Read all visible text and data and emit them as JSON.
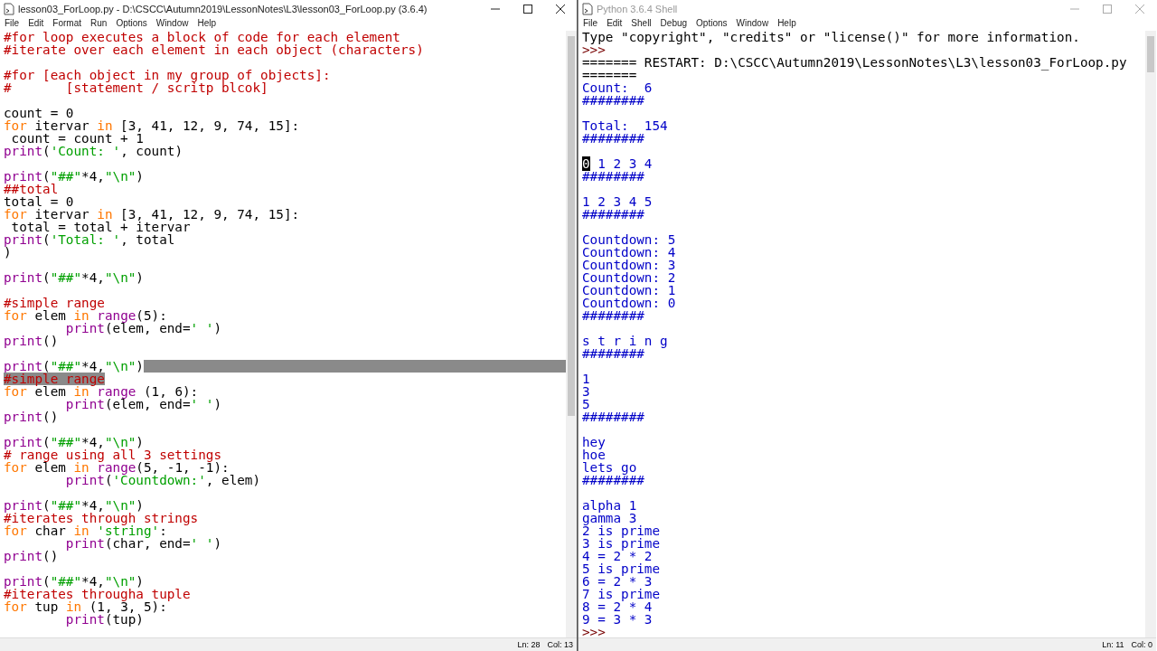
{
  "editor": {
    "title": "lesson03_ForLoop.py - D:\\CSCC\\Autumn2019\\LessonNotes\\L3\\lesson03_ForLoop.py (3.6.4)",
    "active": true,
    "menu": [
      "File",
      "Edit",
      "Format",
      "Run",
      "Options",
      "Window",
      "Help"
    ],
    "lines": [
      {
        "kind": "code",
        "tokens": [
          {
            "kind": "comment",
            "text": "#for loop executes a block of code for each element"
          }
        ]
      },
      {
        "kind": "code",
        "tokens": [
          {
            "kind": "comment",
            "text": "#iterate over each element in each object (characters)"
          }
        ]
      },
      {
        "kind": "blank"
      },
      {
        "kind": "code",
        "tokens": [
          {
            "kind": "comment",
            "text": "#for [each object in my group of objects]:"
          }
        ]
      },
      {
        "kind": "code",
        "tokens": [
          {
            "kind": "comment",
            "text": "#       [statement / scritp blcok]"
          }
        ]
      },
      {
        "kind": "blank"
      },
      {
        "kind": "code",
        "tokens": [
          {
            "kind": "plain",
            "text": "count = 0"
          }
        ]
      },
      {
        "kind": "code",
        "tokens": [
          {
            "kind": "keyword",
            "text": "for"
          },
          {
            "kind": "plain",
            "text": " itervar "
          },
          {
            "kind": "keyword",
            "text": "in"
          },
          {
            "kind": "plain",
            "text": " [3, 41, 12, 9, 74, 15]:"
          }
        ]
      },
      {
        "kind": "code",
        "tokens": [
          {
            "kind": "plain",
            "text": " count = count + 1"
          }
        ]
      },
      {
        "kind": "code",
        "tokens": [
          {
            "kind": "builtin",
            "text": "print"
          },
          {
            "kind": "plain",
            "text": "("
          },
          {
            "kind": "string",
            "text": "'Count: '"
          },
          {
            "kind": "plain",
            "text": ", count)"
          }
        ]
      },
      {
        "kind": "blank"
      },
      {
        "kind": "code",
        "tokens": [
          {
            "kind": "builtin",
            "text": "print"
          },
          {
            "kind": "plain",
            "text": "("
          },
          {
            "kind": "string",
            "text": "\"##\""
          },
          {
            "kind": "plain",
            "text": "*4,"
          },
          {
            "kind": "string",
            "text": "\"\\n\""
          },
          {
            "kind": "plain",
            "text": ")"
          }
        ]
      },
      {
        "kind": "code",
        "tokens": [
          {
            "kind": "comment",
            "text": "##total"
          }
        ]
      },
      {
        "kind": "code",
        "tokens": [
          {
            "kind": "plain",
            "text": "total = 0"
          }
        ]
      },
      {
        "kind": "code",
        "tokens": [
          {
            "kind": "keyword",
            "text": "for"
          },
          {
            "kind": "plain",
            "text": " itervar "
          },
          {
            "kind": "keyword",
            "text": "in"
          },
          {
            "kind": "plain",
            "text": " [3, 41, 12, 9, 74, 15]:"
          }
        ]
      },
      {
        "kind": "code",
        "tokens": [
          {
            "kind": "plain",
            "text": " total = total + itervar"
          }
        ]
      },
      {
        "kind": "code",
        "tokens": [
          {
            "kind": "builtin",
            "text": "print"
          },
          {
            "kind": "plain",
            "text": "("
          },
          {
            "kind": "string",
            "text": "'Total: '"
          },
          {
            "kind": "plain",
            "text": ", total"
          }
        ]
      },
      {
        "kind": "code",
        "tokens": [
          {
            "kind": "plain",
            "text": ")"
          }
        ]
      },
      {
        "kind": "blank"
      },
      {
        "kind": "code",
        "tokens": [
          {
            "kind": "builtin",
            "text": "print"
          },
          {
            "kind": "plain",
            "text": "("
          },
          {
            "kind": "string",
            "text": "\"##\""
          },
          {
            "kind": "plain",
            "text": "*4,"
          },
          {
            "kind": "string",
            "text": "\"\\n\""
          },
          {
            "kind": "plain",
            "text": ")"
          }
        ]
      },
      {
        "kind": "blank"
      },
      {
        "kind": "code",
        "tokens": [
          {
            "kind": "comment",
            "text": "#simple range"
          }
        ]
      },
      {
        "kind": "code",
        "tokens": [
          {
            "kind": "keyword",
            "text": "for"
          },
          {
            "kind": "plain",
            "text": " elem "
          },
          {
            "kind": "keyword",
            "text": "in "
          },
          {
            "kind": "builtin",
            "text": "range"
          },
          {
            "kind": "plain",
            "text": "(5):"
          }
        ]
      },
      {
        "kind": "code",
        "indented": true,
        "tokens": [
          {
            "kind": "builtin",
            "text": "print"
          },
          {
            "kind": "plain",
            "text": "(elem, end="
          },
          {
            "kind": "string",
            "text": "' '"
          },
          {
            "kind": "plain",
            "text": ")"
          }
        ]
      },
      {
        "kind": "code",
        "tokens": [
          {
            "kind": "builtin",
            "text": "print"
          },
          {
            "kind": "plain",
            "text": "()"
          }
        ]
      },
      {
        "kind": "blank"
      },
      {
        "kind": "code",
        "selection_tail": true,
        "tokens": [
          {
            "kind": "builtin",
            "text": "print"
          },
          {
            "kind": "plain",
            "text": "("
          },
          {
            "kind": "string",
            "text": "\"##\""
          },
          {
            "kind": "plain",
            "text": "*4,"
          },
          {
            "kind": "string",
            "text": "\"\\n\""
          },
          {
            "kind": "plain",
            "text": ")"
          }
        ]
      },
      {
        "kind": "code",
        "selected": true,
        "tokens": [
          {
            "kind": "comment",
            "text": "#simple range"
          }
        ]
      },
      {
        "kind": "code",
        "tokens": [
          {
            "kind": "keyword",
            "text": "for"
          },
          {
            "kind": "plain",
            "text": " elem "
          },
          {
            "kind": "keyword",
            "text": "in "
          },
          {
            "kind": "builtin",
            "text": "range"
          },
          {
            "kind": "plain",
            "text": " (1, 6):"
          }
        ]
      },
      {
        "kind": "code",
        "indented": true,
        "tokens": [
          {
            "kind": "builtin",
            "text": "print"
          },
          {
            "kind": "plain",
            "text": "(elem, end="
          },
          {
            "kind": "string",
            "text": "' '"
          },
          {
            "kind": "plain",
            "text": ")"
          }
        ]
      },
      {
        "kind": "code",
        "tokens": [
          {
            "kind": "builtin",
            "text": "print"
          },
          {
            "kind": "plain",
            "text": "()"
          }
        ]
      },
      {
        "kind": "blank"
      },
      {
        "kind": "code",
        "tokens": [
          {
            "kind": "builtin",
            "text": "print"
          },
          {
            "kind": "plain",
            "text": "("
          },
          {
            "kind": "string",
            "text": "\"##\""
          },
          {
            "kind": "plain",
            "text": "*4,"
          },
          {
            "kind": "string",
            "text": "\"\\n\""
          },
          {
            "kind": "plain",
            "text": ")"
          }
        ]
      },
      {
        "kind": "code",
        "tokens": [
          {
            "kind": "comment",
            "text": "# range using all 3 settings"
          }
        ]
      },
      {
        "kind": "code",
        "tokens": [
          {
            "kind": "keyword",
            "text": "for"
          },
          {
            "kind": "plain",
            "text": " elem "
          },
          {
            "kind": "keyword",
            "text": "in "
          },
          {
            "kind": "builtin",
            "text": "range"
          },
          {
            "kind": "plain",
            "text": "(5, -1, -1):"
          }
        ]
      },
      {
        "kind": "code",
        "indented": true,
        "tokens": [
          {
            "kind": "builtin",
            "text": "print"
          },
          {
            "kind": "plain",
            "text": "("
          },
          {
            "kind": "string",
            "text": "'Countdown:'"
          },
          {
            "kind": "plain",
            "text": ", elem)"
          }
        ]
      },
      {
        "kind": "blank"
      },
      {
        "kind": "code",
        "tokens": [
          {
            "kind": "builtin",
            "text": "print"
          },
          {
            "kind": "plain",
            "text": "("
          },
          {
            "kind": "string",
            "text": "\"##\""
          },
          {
            "kind": "plain",
            "text": "*4,"
          },
          {
            "kind": "string",
            "text": "\"\\n\""
          },
          {
            "kind": "plain",
            "text": ")"
          }
        ]
      },
      {
        "kind": "code",
        "tokens": [
          {
            "kind": "comment",
            "text": "#iterates through strings"
          }
        ]
      },
      {
        "kind": "code",
        "tokens": [
          {
            "kind": "keyword",
            "text": "for"
          },
          {
            "kind": "plain",
            "text": " char "
          },
          {
            "kind": "keyword",
            "text": "in "
          },
          {
            "kind": "string",
            "text": "'string'"
          },
          {
            "kind": "plain",
            "text": ":"
          }
        ]
      },
      {
        "kind": "code",
        "indented": true,
        "tokens": [
          {
            "kind": "builtin",
            "text": "print"
          },
          {
            "kind": "plain",
            "text": "(char, end="
          },
          {
            "kind": "string",
            "text": "' '"
          },
          {
            "kind": "plain",
            "text": ")"
          }
        ]
      },
      {
        "kind": "code",
        "tokens": [
          {
            "kind": "builtin",
            "text": "print"
          },
          {
            "kind": "plain",
            "text": "()"
          }
        ]
      },
      {
        "kind": "blank"
      },
      {
        "kind": "code",
        "tokens": [
          {
            "kind": "builtin",
            "text": "print"
          },
          {
            "kind": "plain",
            "text": "("
          },
          {
            "kind": "string",
            "text": "\"##\""
          },
          {
            "kind": "plain",
            "text": "*4,"
          },
          {
            "kind": "string",
            "text": "\"\\n\""
          },
          {
            "kind": "plain",
            "text": ")"
          }
        ]
      },
      {
        "kind": "code",
        "tokens": [
          {
            "kind": "comment",
            "text": "#iterates througha tuple"
          }
        ]
      },
      {
        "kind": "code",
        "tokens": [
          {
            "kind": "keyword",
            "text": "for"
          },
          {
            "kind": "plain",
            "text": " tup "
          },
          {
            "kind": "keyword",
            "text": "in"
          },
          {
            "kind": "plain",
            "text": " (1, 3, 5):"
          }
        ]
      },
      {
        "kind": "code",
        "indented": true,
        "tokens": [
          {
            "kind": "builtin",
            "text": "print"
          },
          {
            "kind": "plain",
            "text": "(tup)"
          }
        ]
      }
    ],
    "status": {
      "line": "Ln: 28",
      "column": "Col: 13"
    }
  },
  "shell": {
    "title": "Python 3.6.4 Shell",
    "active": false,
    "menu": [
      "File",
      "Edit",
      "Shell",
      "Debug",
      "Options",
      "Window",
      "Help"
    ],
    "lines": [
      {
        "kind": "code",
        "tokens": [
          {
            "kind": "plain",
            "text": "Type \"copyright\", \"credits\" or \"license()\" for more information."
          }
        ]
      },
      {
        "kind": "code",
        "tokens": [
          {
            "kind": "prompt",
            "text": ">>> "
          }
        ]
      },
      {
        "kind": "code",
        "tokens": [
          {
            "kind": "plain",
            "text": "======= RESTART: D:\\CSCC\\Autumn2019\\LessonNotes\\L3\\lesson03_ForLoop.py"
          }
        ]
      },
      {
        "kind": "code",
        "tokens": [
          {
            "kind": "plain",
            "text": "======="
          }
        ]
      },
      {
        "kind": "code",
        "tokens": [
          {
            "kind": "output",
            "text": "Count:  6"
          }
        ]
      },
      {
        "kind": "code",
        "tokens": [
          {
            "kind": "output",
            "text": "########"
          }
        ]
      },
      {
        "kind": "blank"
      },
      {
        "kind": "code",
        "tokens": [
          {
            "kind": "output",
            "text": "Total:  154"
          }
        ]
      },
      {
        "kind": "code",
        "tokens": [
          {
            "kind": "output",
            "text": "########"
          }
        ]
      },
      {
        "kind": "blank"
      },
      {
        "kind": "code",
        "tokens": [
          {
            "kind": "cursor",
            "text": "0"
          },
          {
            "kind": "output",
            "text": " 1 2 3 4"
          }
        ]
      },
      {
        "kind": "code",
        "tokens": [
          {
            "kind": "output",
            "text": "########"
          }
        ]
      },
      {
        "kind": "blank"
      },
      {
        "kind": "code",
        "tokens": [
          {
            "kind": "output",
            "text": "1 2 3 4 5"
          }
        ]
      },
      {
        "kind": "code",
        "tokens": [
          {
            "kind": "output",
            "text": "########"
          }
        ]
      },
      {
        "kind": "blank"
      },
      {
        "kind": "code",
        "tokens": [
          {
            "kind": "output",
            "text": "Countdown: 5"
          }
        ]
      },
      {
        "kind": "code",
        "tokens": [
          {
            "kind": "output",
            "text": "Countdown: 4"
          }
        ]
      },
      {
        "kind": "code",
        "tokens": [
          {
            "kind": "output",
            "text": "Countdown: 3"
          }
        ]
      },
      {
        "kind": "code",
        "tokens": [
          {
            "kind": "output",
            "text": "Countdown: 2"
          }
        ]
      },
      {
        "kind": "code",
        "tokens": [
          {
            "kind": "output",
            "text": "Countdown: 1"
          }
        ]
      },
      {
        "kind": "code",
        "tokens": [
          {
            "kind": "output",
            "text": "Countdown: 0"
          }
        ]
      },
      {
        "kind": "code",
        "tokens": [
          {
            "kind": "output",
            "text": "########"
          }
        ]
      },
      {
        "kind": "blank"
      },
      {
        "kind": "code",
        "tokens": [
          {
            "kind": "output",
            "text": "s t r i n g"
          }
        ]
      },
      {
        "kind": "code",
        "tokens": [
          {
            "kind": "output",
            "text": "########"
          }
        ]
      },
      {
        "kind": "blank"
      },
      {
        "kind": "code",
        "tokens": [
          {
            "kind": "output",
            "text": "1"
          }
        ]
      },
      {
        "kind": "code",
        "tokens": [
          {
            "kind": "output",
            "text": "3"
          }
        ]
      },
      {
        "kind": "code",
        "tokens": [
          {
            "kind": "output",
            "text": "5"
          }
        ]
      },
      {
        "kind": "code",
        "tokens": [
          {
            "kind": "output",
            "text": "########"
          }
        ]
      },
      {
        "kind": "blank"
      },
      {
        "kind": "code",
        "tokens": [
          {
            "kind": "output",
            "text": "hey"
          }
        ]
      },
      {
        "kind": "code",
        "tokens": [
          {
            "kind": "output",
            "text": "hoe"
          }
        ]
      },
      {
        "kind": "code",
        "tokens": [
          {
            "kind": "output",
            "text": "lets go"
          }
        ]
      },
      {
        "kind": "code",
        "tokens": [
          {
            "kind": "output",
            "text": "########"
          }
        ]
      },
      {
        "kind": "blank"
      },
      {
        "kind": "code",
        "tokens": [
          {
            "kind": "output",
            "text": "alpha 1"
          }
        ]
      },
      {
        "kind": "code",
        "tokens": [
          {
            "kind": "output",
            "text": "gamma 3"
          }
        ]
      },
      {
        "kind": "code",
        "tokens": [
          {
            "kind": "output",
            "text": "2 is prime"
          }
        ]
      },
      {
        "kind": "code",
        "tokens": [
          {
            "kind": "output",
            "text": "3 is prime"
          }
        ]
      },
      {
        "kind": "code",
        "tokens": [
          {
            "kind": "output",
            "text": "4 = 2 * 2"
          }
        ]
      },
      {
        "kind": "code",
        "tokens": [
          {
            "kind": "output",
            "text": "5 is prime"
          }
        ]
      },
      {
        "kind": "code",
        "tokens": [
          {
            "kind": "output",
            "text": "6 = 2 * 3"
          }
        ]
      },
      {
        "kind": "code",
        "tokens": [
          {
            "kind": "output",
            "text": "7 is prime"
          }
        ]
      },
      {
        "kind": "code",
        "tokens": [
          {
            "kind": "output",
            "text": "8 = 2 * 4"
          }
        ]
      },
      {
        "kind": "code",
        "tokens": [
          {
            "kind": "output",
            "text": "9 = 3 * 3"
          }
        ]
      },
      {
        "kind": "code",
        "tokens": [
          {
            "kind": "prompt",
            "text": ">>> "
          }
        ]
      }
    ],
    "status": {
      "line": "Ln: 11",
      "column": "Col: 0"
    }
  }
}
